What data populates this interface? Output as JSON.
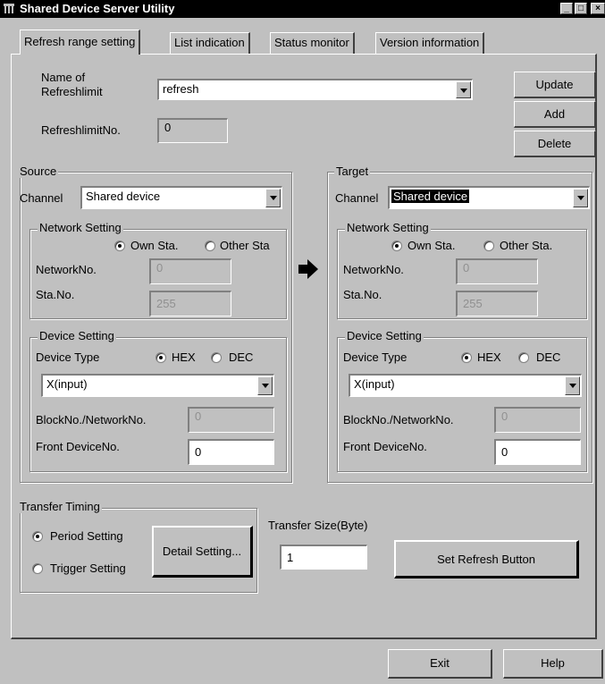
{
  "window": {
    "title": "Shared Device Server Utility"
  },
  "tabs": [
    {
      "label": "Refresh range setting",
      "active": true
    },
    {
      "label": "List indication",
      "active": false
    },
    {
      "label": "Status monitor",
      "active": false
    },
    {
      "label": "Version information",
      "active": false
    }
  ],
  "refresh": {
    "name_label": "Name of\nRefreshlimit",
    "name_value": "refresh",
    "no_label": "RefreshlimitNo.",
    "no_value": "0"
  },
  "buttons": {
    "update": "Update",
    "add": "Add",
    "delete": "Delete",
    "detail": "Detail Setting...",
    "set_refresh": "Set Refresh Button",
    "exit": "Exit",
    "help": "Help"
  },
  "source": {
    "title": "Source",
    "channel_label": "Channel",
    "channel_value": "Shared device",
    "network": {
      "title": "Network Setting",
      "own": "Own Sta.",
      "other": "Other Sta",
      "network_no_label": "NetworkNo.",
      "network_no_value": "0",
      "sta_no_label": "Sta.No.",
      "sta_no_value": "255"
    },
    "device": {
      "title": "Device Setting",
      "type_label": "Device Type",
      "hex": "HEX",
      "dec": "DEC",
      "type_value": "X(input)",
      "block_label": "BlockNo./NetworkNo.",
      "block_value": "0",
      "front_label": "Front DeviceNo.",
      "front_value": "0"
    }
  },
  "target": {
    "title": "Target",
    "channel_label": "Channel",
    "channel_value": "Shared device",
    "network": {
      "title": "Network Setting",
      "own": "Own Sta.",
      "other": "Other Sta.",
      "network_no_label": "NetworkNo.",
      "network_no_value": "0",
      "sta_no_label": "Sta.No.",
      "sta_no_value": "255"
    },
    "device": {
      "title": "Device Setting",
      "type_label": "Device Type",
      "hex": "HEX",
      "dec": "DEC",
      "type_value": "X(input)",
      "block_label": "BlockNo./NetworkNo.",
      "block_value": "0",
      "front_label": "Front DeviceNo.",
      "front_value": "0"
    }
  },
  "transfer": {
    "timing_title": "Transfer Timing",
    "period": "Period Setting",
    "trigger": "Trigger Setting",
    "size_label": "Transfer Size(Byte)",
    "size_value": "1"
  },
  "icons": {
    "app": "network-icon",
    "arrow": "right-arrow-icon"
  }
}
